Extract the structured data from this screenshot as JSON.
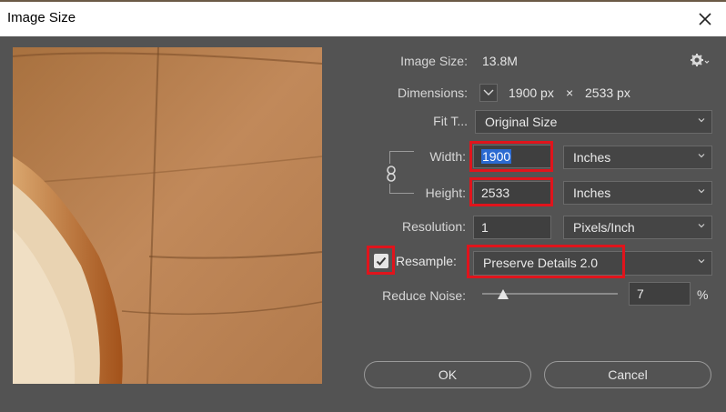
{
  "window": {
    "title": "Image Size"
  },
  "info": {
    "image_size_label": "Image Size:",
    "image_size_value": "13.8M",
    "dimensions_label": "Dimensions:",
    "dim_width": "1900 px",
    "dim_times": "×",
    "dim_height": "2533 px"
  },
  "fit_to": {
    "label": "Fit T...",
    "value": "Original Size"
  },
  "width": {
    "label": "Width:",
    "value": "1900",
    "unit": "Inches"
  },
  "height": {
    "label": "Height:",
    "value": "2533",
    "unit": "Inches"
  },
  "resolution": {
    "label": "Resolution:",
    "value": "1",
    "unit": "Pixels/Inch"
  },
  "resample": {
    "label": "Resample:",
    "checked": true,
    "method": "Preserve Details 2.0"
  },
  "reduce_noise": {
    "label": "Reduce Noise:",
    "value": "7",
    "unit": "%",
    "slider_fraction": 0.07
  },
  "buttons": {
    "ok": "OK",
    "cancel": "Cancel"
  },
  "colors": {
    "highlight": "#e0141c",
    "selection": "#2b6ad1",
    "background": "#535353"
  },
  "icons": [
    "close-icon",
    "gear-icon",
    "chevron-down-icon",
    "link-icon",
    "check-icon"
  ]
}
